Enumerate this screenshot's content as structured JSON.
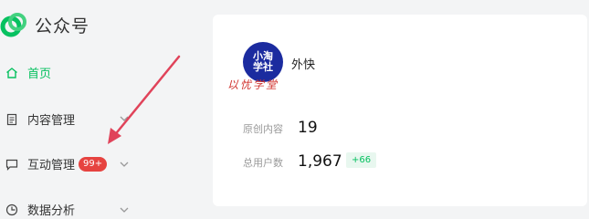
{
  "brand": {
    "name": "公众号",
    "logo_icon": "wechat-official-logo-icon"
  },
  "nav": [
    {
      "label": "首页",
      "icon": "home-icon",
      "active": true
    },
    {
      "label": "内容管理",
      "icon": "document-icon",
      "has_chevron": true
    },
    {
      "label": "互动管理",
      "icon": "message-icon",
      "badge": "99+",
      "has_chevron": true
    },
    {
      "label": "数据分析",
      "icon": "clock-chart-icon",
      "has_chevron": true
    }
  ],
  "account": {
    "avatar_text": "小淘学社",
    "name": "外快",
    "watermark": "以忧学堂"
  },
  "stats": [
    {
      "label": "原创内容",
      "value": "19"
    },
    {
      "label": "总用户数",
      "value": "1,967",
      "delta": "+66"
    }
  ],
  "colors": {
    "accent": "#07c160",
    "badge": "#e64340",
    "arrow": "#e0435a",
    "avatar_bg": "#1b2b9f"
  }
}
